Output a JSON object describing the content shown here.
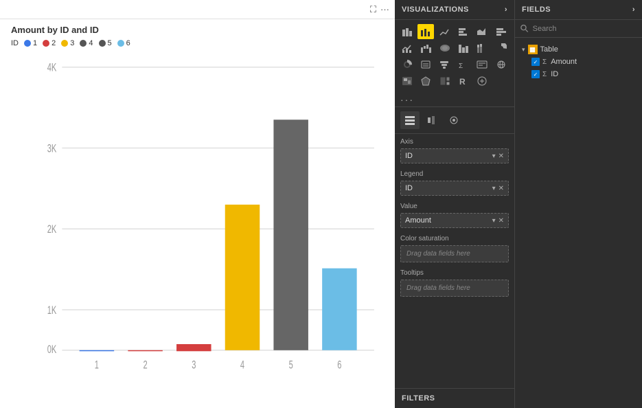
{
  "chart": {
    "title": "Amount by ID and ID",
    "legend_label": "ID",
    "legend_items": [
      {
        "id": "1",
        "color": "#3b78e7"
      },
      {
        "id": "2",
        "color": "#d43e3e"
      },
      {
        "id": "3",
        "color": "#f0b800"
      },
      {
        "id": "4",
        "color": "#555"
      },
      {
        "id": "5",
        "color": "#555"
      },
      {
        "id": "6",
        "color": "#6bbde6"
      }
    ],
    "y_labels": [
      "4K",
      "3K",
      "2K",
      "1K",
      "0K"
    ],
    "x_labels": [
      "1",
      "2",
      "3",
      "4",
      "5",
      "6"
    ],
    "bars": [
      {
        "id": 1,
        "value": 0,
        "color": "#3b78e7",
        "label": "1"
      },
      {
        "id": 2,
        "value": 0,
        "color": "#d43e3e",
        "label": "2"
      },
      {
        "id": 3,
        "value": 280,
        "color": "#d43e3e",
        "label": "3"
      },
      {
        "id": 4,
        "value": 2050,
        "color": "#f0b800",
        "label": "4"
      },
      {
        "id": 5,
        "value": 3250,
        "color": "#666",
        "label": "5"
      },
      {
        "id": 6,
        "value": 1150,
        "color": "#6bbde6",
        "label": "6"
      }
    ],
    "max_value": 4000
  },
  "visualizations": {
    "header": "VISUALIZATIONS",
    "chevron": "›"
  },
  "fields_panel": {
    "header": "FIELDS",
    "chevron": "›",
    "search_placeholder": "Search",
    "tree": {
      "group_name": "Table",
      "items": [
        {
          "name": "Amount",
          "checked": true
        },
        {
          "name": "ID",
          "checked": true
        }
      ]
    }
  },
  "viz_fields": {
    "axis_label": "Axis",
    "axis_value": "ID",
    "legend_label": "Legend",
    "legend_value": "ID",
    "value_label": "Value",
    "value_value": "Amount",
    "color_saturation_label": "Color saturation",
    "color_saturation_placeholder": "Drag data fields here",
    "tooltips_label": "Tooltips",
    "tooltips_placeholder": "Drag data fields here"
  },
  "filters": {
    "label": "FILTERS"
  }
}
